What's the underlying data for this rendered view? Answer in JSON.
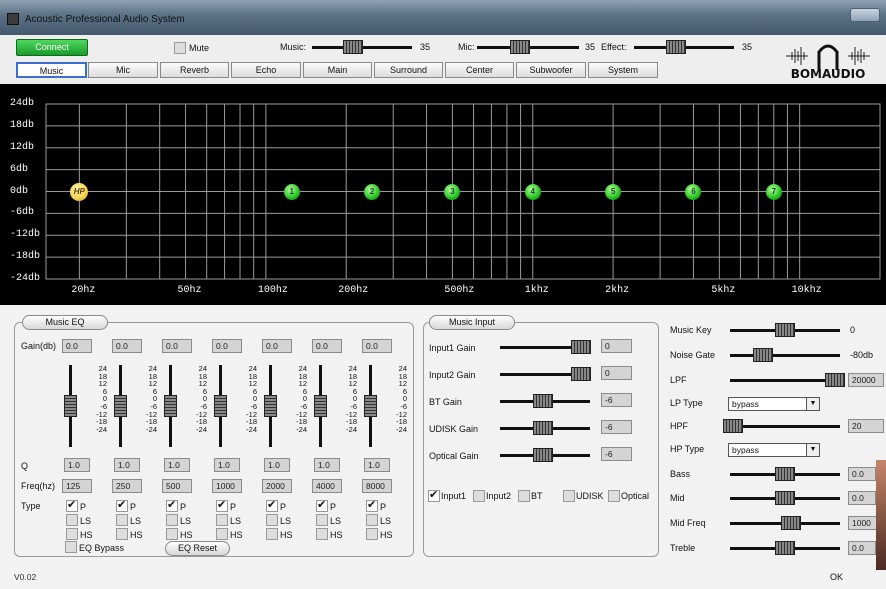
{
  "window": {
    "title": "Acoustic Professional Audio System",
    "version": "V0.02",
    "ok_label": "OK"
  },
  "toolbar": {
    "connect_label": "Connect",
    "mute_label": "Mute",
    "music_label": "Music:",
    "music_value": "35",
    "mic_label": "Mic:",
    "mic_value": "35",
    "effect_label": "Effect:",
    "effect_value": "35"
  },
  "tabs": [
    "Music",
    "Mic",
    "Reverb",
    "Echo",
    "Main",
    "Surround",
    "Center",
    "Subwoofer",
    "System"
  ],
  "selected_tab": "Music",
  "logo_text": "BOMAUDIO",
  "eq_graph": {
    "db_labels": [
      "24db",
      "18db",
      "12db",
      "6db",
      "0db",
      "-6db",
      "-12db",
      "-18db",
      "-24db"
    ],
    "hz_labels": [
      "20hz",
      "50hz",
      "100hz",
      "200hz",
      "500hz",
      "1khz",
      "2khz",
      "5khz",
      "10khz"
    ],
    "nodes": [
      {
        "label": "HP",
        "freq": 20,
        "gain": 0
      },
      {
        "label": "1",
        "freq": 125,
        "gain": 0
      },
      {
        "label": "2",
        "freq": 250,
        "gain": 0
      },
      {
        "label": "3",
        "freq": 500,
        "gain": 0
      },
      {
        "label": "4",
        "freq": 1000,
        "gain": 0
      },
      {
        "label": "5",
        "freq": 2000,
        "gain": 0
      },
      {
        "label": "6",
        "freq": 4000,
        "gain": 0
      },
      {
        "label": "7",
        "freq": 8000,
        "gain": 0
      }
    ]
  },
  "music_eq": {
    "title": "Music EQ",
    "gain_label": "Gain(db)",
    "q_label": "Q",
    "freq_label": "Freq(hz)",
    "type_label": "Type",
    "scale_text": "24\n18\n12\n6\n0\n-6\n-12\n-18\n-24",
    "type_options": [
      "P",
      "LS",
      "HS"
    ],
    "bands": [
      {
        "gain": "0.0",
        "q": "1.0",
        "freq": "125"
      },
      {
        "gain": "0.0",
        "q": "1.0",
        "freq": "250"
      },
      {
        "gain": "0.0",
        "q": "1.0",
        "freq": "500"
      },
      {
        "gain": "0.0",
        "q": "1.0",
        "freq": "1000"
      },
      {
        "gain": "0.0",
        "q": "1.0",
        "freq": "2000"
      },
      {
        "gain": "0.0",
        "q": "1.0",
        "freq": "4000"
      },
      {
        "gain": "0.0",
        "q": "1.0",
        "freq": "8000"
      }
    ],
    "eq_bypass_label": "EQ Bypass",
    "eq_reset_label": "EQ Reset"
  },
  "music_input": {
    "title": "Music Input",
    "rows": [
      {
        "label": "Input1 Gain",
        "value": "0",
        "level": 0.9
      },
      {
        "label": "Input2 Gain",
        "value": "0",
        "level": 0.9
      },
      {
        "label": "BT Gain",
        "value": "-6",
        "level": 0.48
      },
      {
        "label": "UDISK Gain",
        "value": "-6",
        "level": 0.48
      },
      {
        "label": "Optical Gain",
        "value": "-6",
        "level": 0.48
      }
    ],
    "sources": [
      {
        "label": "Input1",
        "checked": true
      },
      {
        "label": "Input2",
        "checked": false
      },
      {
        "label": "BT",
        "checked": false
      },
      {
        "label": "UDISK",
        "checked": false
      },
      {
        "label": "Optical",
        "checked": false
      }
    ]
  },
  "right_panel": {
    "music_key": {
      "label": "Music Key",
      "value": "0"
    },
    "noise_gate": {
      "label": "Noise Gate",
      "value": "-80db"
    },
    "lpf": {
      "label": "LPF",
      "value": "20000"
    },
    "lp_type": {
      "label": "LP Type",
      "value": "bypass"
    },
    "hpf": {
      "label": "HPF",
      "value": "20"
    },
    "hp_type": {
      "label": "HP Type",
      "value": "bypass"
    },
    "bass": {
      "label": "Bass",
      "value": "0.0"
    },
    "mid": {
      "label": "Mid",
      "value": "0.0"
    },
    "mid_freq": {
      "label": "Mid Freq",
      "value": "1000"
    },
    "treble": {
      "label": "Treble",
      "value": "0.0"
    }
  }
}
